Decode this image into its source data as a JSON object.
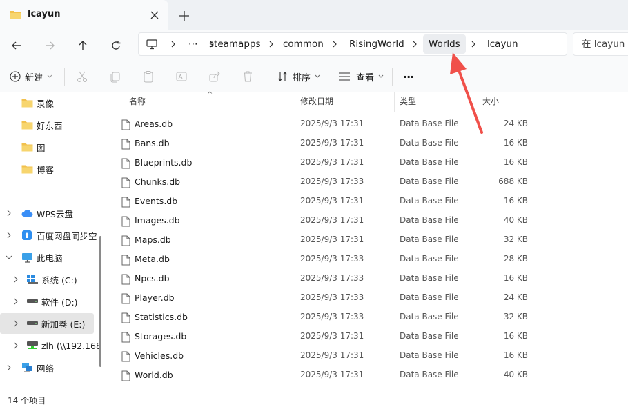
{
  "window": {
    "tab_title": "lcayun",
    "new_tab_glyph": "+",
    "close_glyph": "✕"
  },
  "nav": {
    "breadcrumb": [
      {
        "label": "⋯"
      },
      {
        "label": "steamapps"
      },
      {
        "label": "common"
      },
      {
        "label": "RisingWorld"
      },
      {
        "label": "Worlds"
      },
      {
        "label": "lcayun"
      }
    ],
    "search_placeholder": "在 lcayun 中"
  },
  "toolbar": {
    "new_label": "新建",
    "sort_label": "排序",
    "view_label": "查看",
    "more_label": "···"
  },
  "sidebar": {
    "quick": [
      {
        "label": "录像"
      },
      {
        "label": "好东西"
      },
      {
        "label": "图"
      },
      {
        "label": "博客"
      }
    ],
    "tree": [
      {
        "label": "WPS云盘"
      },
      {
        "label": "百度网盘同步空"
      },
      {
        "label": "此电脑"
      },
      {
        "label": "系统 (C:)"
      },
      {
        "label": "软件 (D:)"
      },
      {
        "label": "新加卷 (E:)"
      },
      {
        "label": "zlh (\\\\192.168"
      },
      {
        "label": "网络"
      }
    ]
  },
  "columns": {
    "name": "名称",
    "date": "修改日期",
    "type": "类型",
    "size": "大小"
  },
  "files": [
    {
      "name": "Areas.db",
      "date": "2025/9/3 17:31",
      "type": "Data Base File",
      "size": "24 KB"
    },
    {
      "name": "Bans.db",
      "date": "2025/9/3 17:31",
      "type": "Data Base File",
      "size": "16 KB"
    },
    {
      "name": "Blueprints.db",
      "date": "2025/9/3 17:31",
      "type": "Data Base File",
      "size": "16 KB"
    },
    {
      "name": "Chunks.db",
      "date": "2025/9/3 17:33",
      "type": "Data Base File",
      "size": "688 KB"
    },
    {
      "name": "Events.db",
      "date": "2025/9/3 17:31",
      "type": "Data Base File",
      "size": "16 KB"
    },
    {
      "name": "Images.db",
      "date": "2025/9/3 17:31",
      "type": "Data Base File",
      "size": "40 KB"
    },
    {
      "name": "Maps.db",
      "date": "2025/9/3 17:31",
      "type": "Data Base File",
      "size": "32 KB"
    },
    {
      "name": "Meta.db",
      "date": "2025/9/3 17:33",
      "type": "Data Base File",
      "size": "28 KB"
    },
    {
      "name": "Npcs.db",
      "date": "2025/9/3 17:33",
      "type": "Data Base File",
      "size": "16 KB"
    },
    {
      "name": "Player.db",
      "date": "2025/9/3 17:33",
      "type": "Data Base File",
      "size": "24 KB"
    },
    {
      "name": "Statistics.db",
      "date": "2025/9/3 17:33",
      "type": "Data Base File",
      "size": "32 KB"
    },
    {
      "name": "Storages.db",
      "date": "2025/9/3 17:31",
      "type": "Data Base File",
      "size": "16 KB"
    },
    {
      "name": "Vehicles.db",
      "date": "2025/9/3 17:31",
      "type": "Data Base File",
      "size": "16 KB"
    },
    {
      "name": "World.db",
      "date": "2025/9/3 17:31",
      "type": "Data Base File",
      "size": "40 KB"
    }
  ],
  "status": {
    "count_text": "14 个项目"
  },
  "colors": {
    "accent": "#0067c0",
    "folder": "#f2c14e",
    "annotation_arrow": "#f0504a"
  }
}
